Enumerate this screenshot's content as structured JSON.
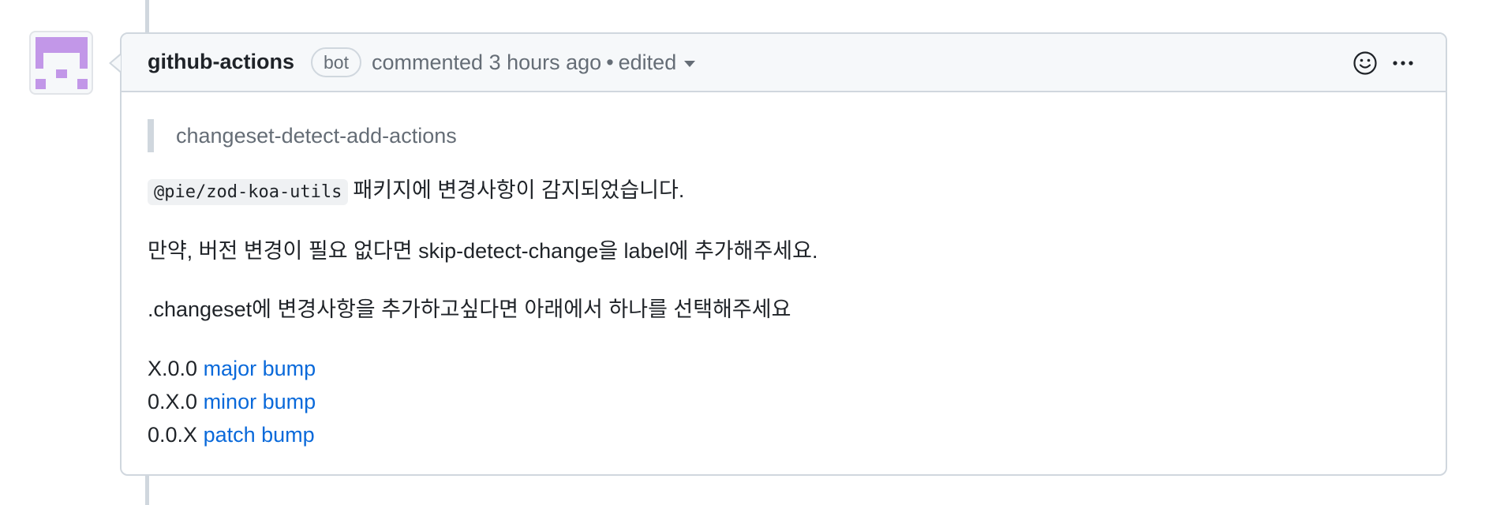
{
  "comment": {
    "author": "github-actions",
    "badge": "bot",
    "meta_text": "commented 3 hours ago",
    "separator": "•",
    "edited_label": "edited",
    "icons": [
      "smiley-icon",
      "kebab-horizontal-icon"
    ],
    "body": {
      "quote": "changeset-detect-add-actions",
      "package_code": "@pie/zod-koa-utils",
      "detected_text": "패키지에 변경사항이 감지되었습니다.",
      "skip_text": "만약, 버전 변경이 필요 없다면 skip-detect-change을 label에 추가해주세요.",
      "select_text": ".changeset에 변경사항을 추가하고싶다면 아래에서 하나를 선택해주세요",
      "bumps": [
        {
          "version": "X.0.0",
          "link_label": "major bump"
        },
        {
          "version": "0.X.0",
          "link_label": "minor bump"
        },
        {
          "version": "0.0.X",
          "link_label": "patch bump"
        }
      ]
    }
  },
  "colors": {
    "link": "#0969da",
    "muted": "#656d76",
    "border": "#d0d7de",
    "avatar_purple": "#c297e8"
  }
}
